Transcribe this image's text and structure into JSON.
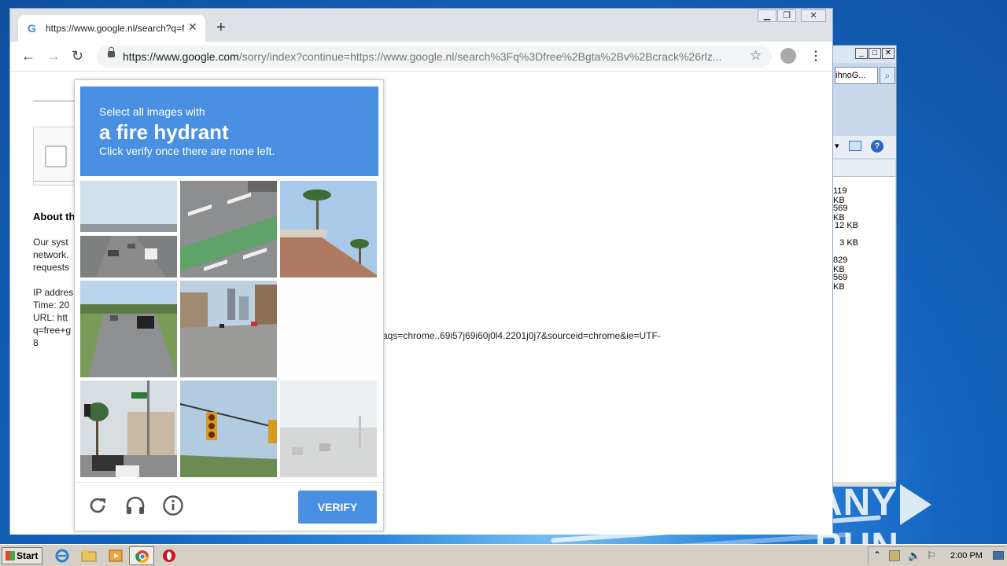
{
  "browser": {
    "tab_title": "https://www.google.nl/search?q=fr",
    "tab_favicon": "G",
    "url_host": "https://www.google.com",
    "url_path": "/sorry/index?continue=https://www.google.nl/search%3Fq%3Dfree%2Bgta%2Bv%2Bcrack%26rlz..."
  },
  "page": {
    "about_heading": "About th",
    "text_lines": [
      "Our syst",
      "network.",
      "requests"
    ],
    "info_lines": [
      "IP addres",
      "Time: 20",
      "URL: htt",
      "q=free+g",
      "8"
    ],
    "url_tail": "aqs=chrome..69i57j69i60j0l4.2201j0j7&sourceid=chrome&ie=UTF-"
  },
  "captcha": {
    "line1": "Select all images with",
    "line2": "a fire hydrant",
    "line3": "Click verify once there are none left.",
    "verify_label": "VERIFY",
    "icons": [
      "reload-icon",
      "audio-icon",
      "info-icon"
    ]
  },
  "explorer": {
    "address": "ihnoG...",
    "sizes": [
      "119 KB",
      "569 KB",
      "12 KB",
      "3 KB",
      "829 KB",
      "569 KB"
    ]
  },
  "taskbar": {
    "start_label": "Start",
    "clock": "2:00 PM"
  },
  "watermark": {
    "left": "ANY",
    "right": "RUN"
  }
}
